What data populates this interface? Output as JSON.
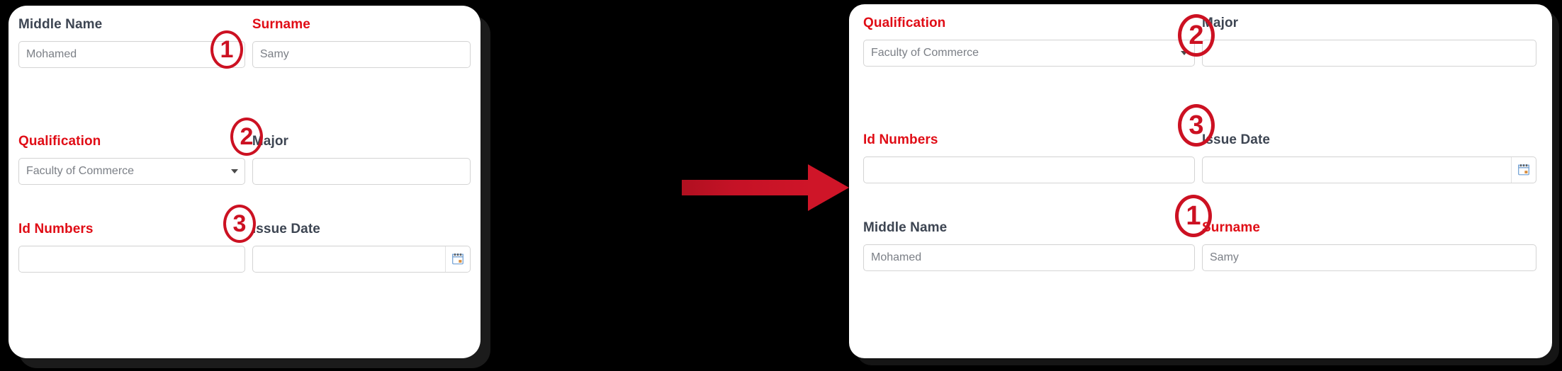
{
  "background_color": "#000000",
  "accent_color": "#cc1122",
  "required_label_color": "#e00d16",
  "label_color": "#3d4552",
  "panels": {
    "before": {
      "name": "before-form",
      "fields": [
        {
          "label": "Middle Name",
          "required": false,
          "type": "text",
          "value": "Mohamed",
          "marker": "1"
        },
        {
          "label": "Surname",
          "required": true,
          "type": "text",
          "value": "Samy",
          "marker": ""
        },
        {
          "label": "Qualification",
          "required": true,
          "type": "select",
          "value": "Faculty of Commerce",
          "marker": "2"
        },
        {
          "label": "Major",
          "required": false,
          "type": "text",
          "value": "",
          "marker": ""
        },
        {
          "label": "Id Numbers",
          "required": true,
          "type": "text",
          "value": "",
          "marker": "3"
        },
        {
          "label": "Issue Date",
          "required": false,
          "type": "date",
          "value": "",
          "marker": ""
        }
      ]
    },
    "after": {
      "name": "after-form",
      "fields": [
        {
          "label": "Qualification",
          "required": true,
          "type": "select",
          "value": "Faculty of Commerce",
          "marker": "2"
        },
        {
          "label": "Major",
          "required": false,
          "type": "text",
          "value": "",
          "marker": ""
        },
        {
          "label": "Id Numbers",
          "required": true,
          "type": "text",
          "value": "",
          "marker": "3"
        },
        {
          "label": "Issue Date",
          "required": false,
          "type": "date",
          "value": "",
          "marker": ""
        },
        {
          "label": "Middle Name",
          "required": false,
          "type": "text",
          "value": "Mohamed",
          "marker": "1"
        },
        {
          "label": "Surname",
          "required": true,
          "type": "text",
          "value": "Samy",
          "marker": ""
        }
      ]
    }
  },
  "arrow": {
    "name": "transform-arrow",
    "color": "#cf1528",
    "direction": "right"
  },
  "icons": {
    "dropdown": "chevron-down-icon",
    "date": "calendar-icon"
  }
}
